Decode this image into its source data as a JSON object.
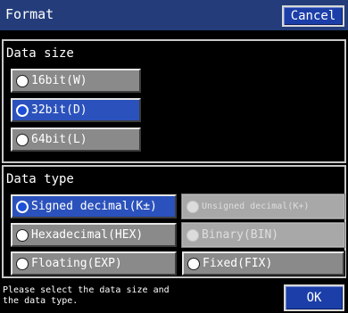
{
  "header": {
    "title": "Format",
    "cancel_label": "Cancel"
  },
  "data_size": {
    "label": "Data size",
    "options": [
      {
        "label": "16bit(W)",
        "selected": false
      },
      {
        "label": "32bit(D)",
        "selected": true
      },
      {
        "label": "64bit(L)",
        "selected": false
      }
    ]
  },
  "data_type": {
    "label": "Data type",
    "options": [
      {
        "label": "Signed decimal(K±)",
        "selected": true,
        "enabled": true
      },
      {
        "label": "Unsigned decimal(K+)",
        "selected": false,
        "enabled": false
      },
      {
        "label": "Hexadecimal(HEX)",
        "selected": false,
        "enabled": true
      },
      {
        "label": "Binary(BIN)",
        "selected": false,
        "enabled": false
      },
      {
        "label": "Floating(EXP)",
        "selected": false,
        "enabled": true
      },
      {
        "label": "Fixed(FIX)",
        "selected": false,
        "enabled": true
      }
    ]
  },
  "footer": {
    "message_line1": "Please select the data size and",
    "message_line2": "the data type.",
    "ok_label": "OK"
  }
}
